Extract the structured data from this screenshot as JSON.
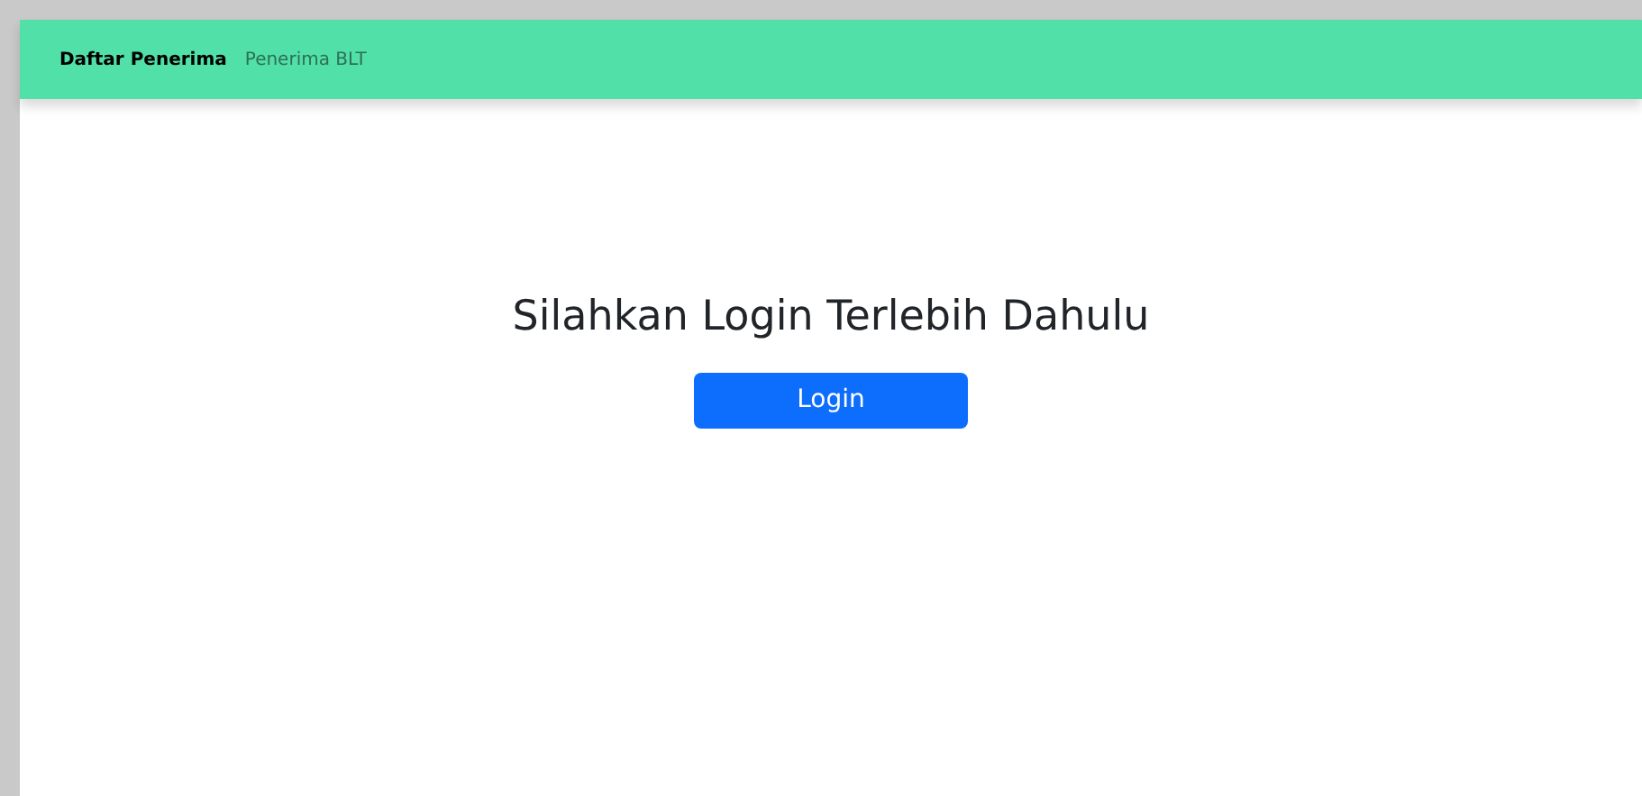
{
  "navbar": {
    "brand": "Daftar Penerima",
    "links": [
      {
        "label": "Penerima BLT",
        "selected": false
      }
    ]
  },
  "main": {
    "heading": "Silahkan Login Terlebih Dahulu",
    "button": "Login"
  }
}
